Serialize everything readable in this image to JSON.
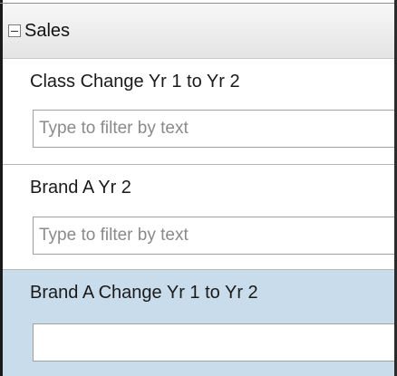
{
  "group": {
    "label": "Sales",
    "expanded": true
  },
  "fields": [
    {
      "label": "Class Change Yr 1 to Yr 2",
      "placeholder": "Type to filter by text",
      "value": ""
    },
    {
      "label": "Brand A Yr 2",
      "placeholder": "Type to filter by text",
      "value": ""
    },
    {
      "label": "Brand A Change Yr 1 to Yr 2",
      "placeholder": "",
      "value": ""
    }
  ],
  "colors": {
    "selected_row_bg": "#c9dceb",
    "header_bg": "#ececec"
  }
}
